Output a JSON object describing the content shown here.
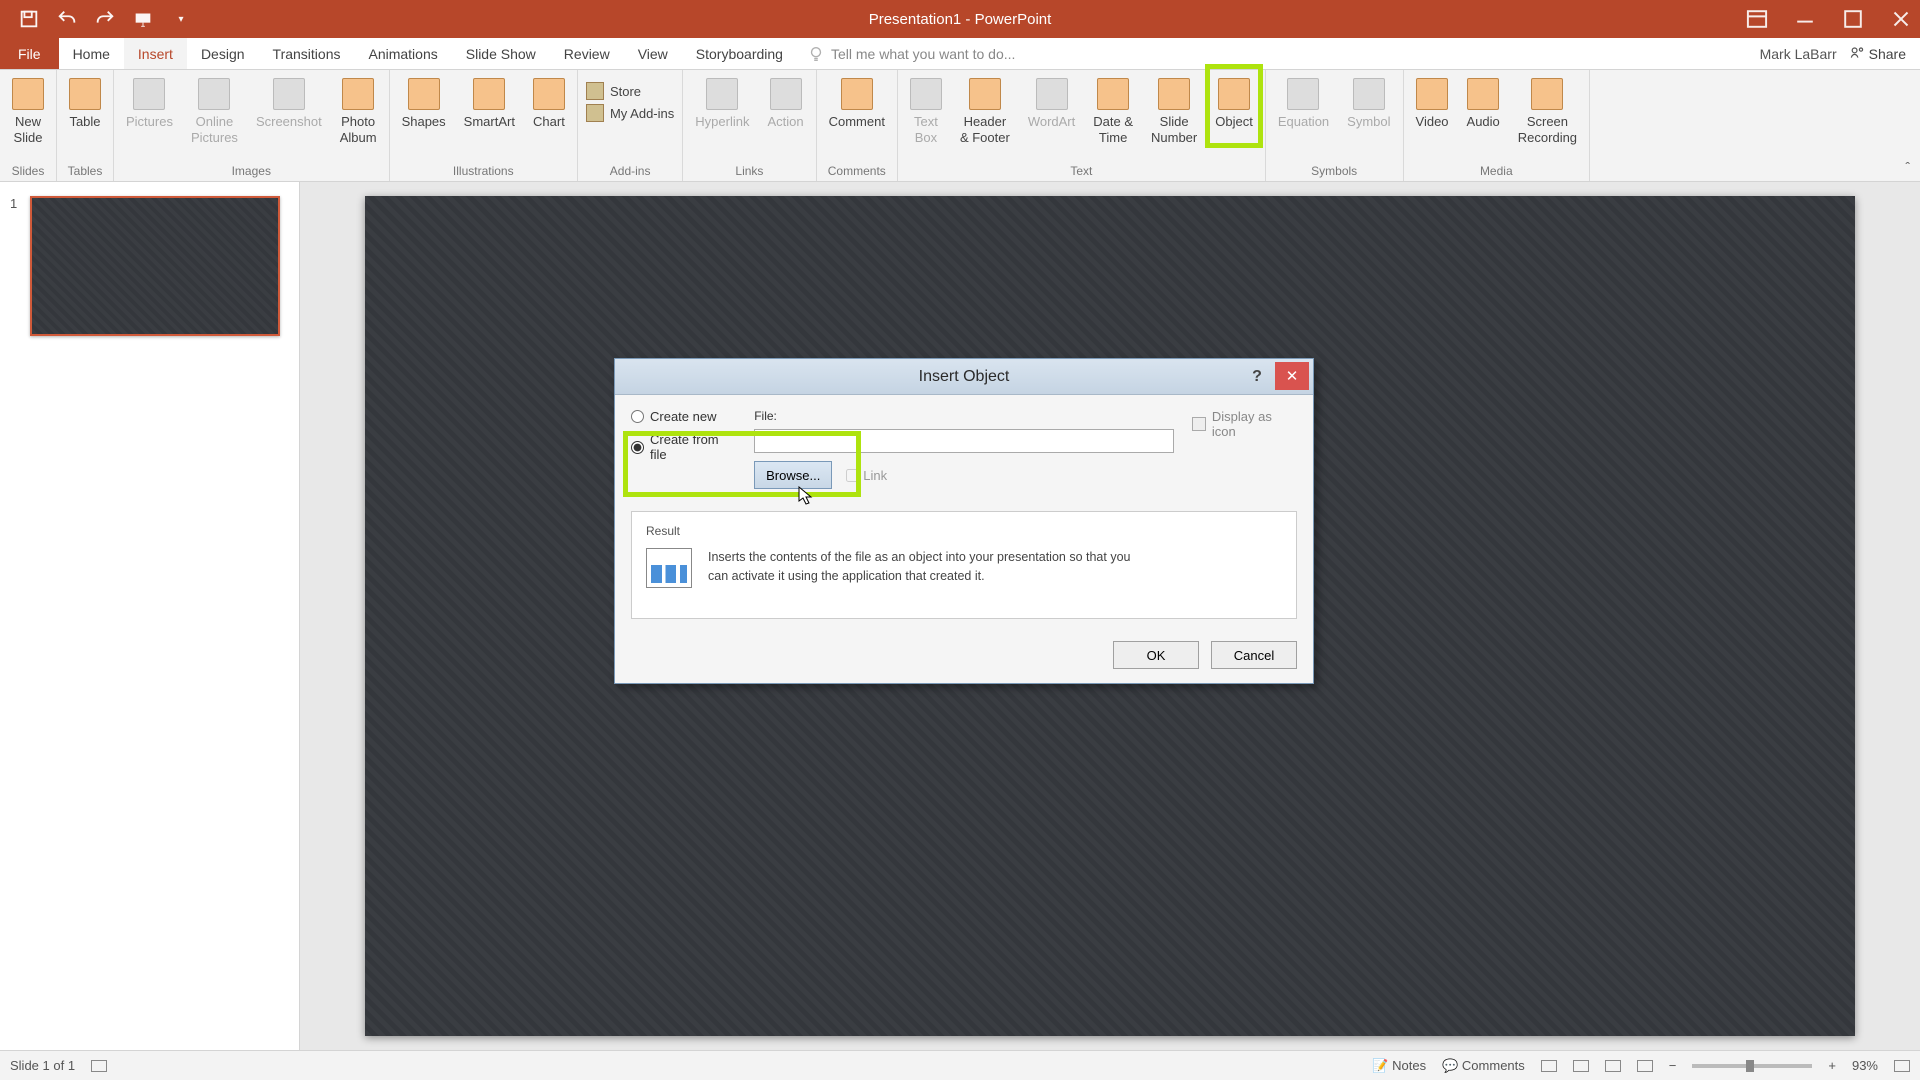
{
  "title": "Presentation1 - PowerPoint",
  "user": "Mark LaBarr",
  "share": "Share",
  "tabs": {
    "file": "File",
    "home": "Home",
    "insert": "Insert",
    "design": "Design",
    "transitions": "Transitions",
    "animations": "Animations",
    "slideshow": "Slide Show",
    "review": "Review",
    "view": "View",
    "storyboarding": "Storyboarding",
    "tellme": "Tell me what you want to do..."
  },
  "ribbon": {
    "slides": {
      "new_slide": "New\nSlide",
      "label": "Slides"
    },
    "tables": {
      "table": "Table",
      "label": "Tables"
    },
    "images": {
      "pictures": "Pictures",
      "online": "Online\nPictures",
      "screenshot": "Screenshot",
      "album": "Photo\nAlbum",
      "label": "Images"
    },
    "illustrations": {
      "shapes": "Shapes",
      "smartart": "SmartArt",
      "chart": "Chart",
      "label": "Illustrations"
    },
    "addins": {
      "store": "Store",
      "myaddins": "My Add-ins",
      "label": "Add-ins"
    },
    "links": {
      "hyperlink": "Hyperlink",
      "action": "Action",
      "label": "Links"
    },
    "comments": {
      "comment": "Comment",
      "label": "Comments"
    },
    "text": {
      "textbox": "Text\nBox",
      "header": "Header\n& Footer",
      "wordart": "WordArt",
      "datetime": "Date &\nTime",
      "slidenum": "Slide\nNumber",
      "object": "Object",
      "label": "Text"
    },
    "symbols": {
      "equation": "Equation",
      "symbol": "Symbol",
      "label": "Symbols"
    },
    "media": {
      "video": "Video",
      "audio": "Audio",
      "screenrec": "Screen\nRecording",
      "label": "Media"
    }
  },
  "thumb": {
    "num": "1"
  },
  "dialog": {
    "title": "Insert Object",
    "create_new": "Create new",
    "create_from_file": "Create from file",
    "file_label": "File:",
    "browse": "Browse...",
    "link": "Link",
    "display_icon": "Display as icon",
    "result_label": "Result",
    "result_text": "Inserts the contents of the file as an object into your presentation so that you can activate it using the application that created it.",
    "ok": "OK",
    "cancel": "Cancel",
    "file_value": ""
  },
  "status": {
    "slide": "Slide 1 of 1",
    "notes": "Notes",
    "comments": "Comments",
    "zoom": "93%"
  }
}
